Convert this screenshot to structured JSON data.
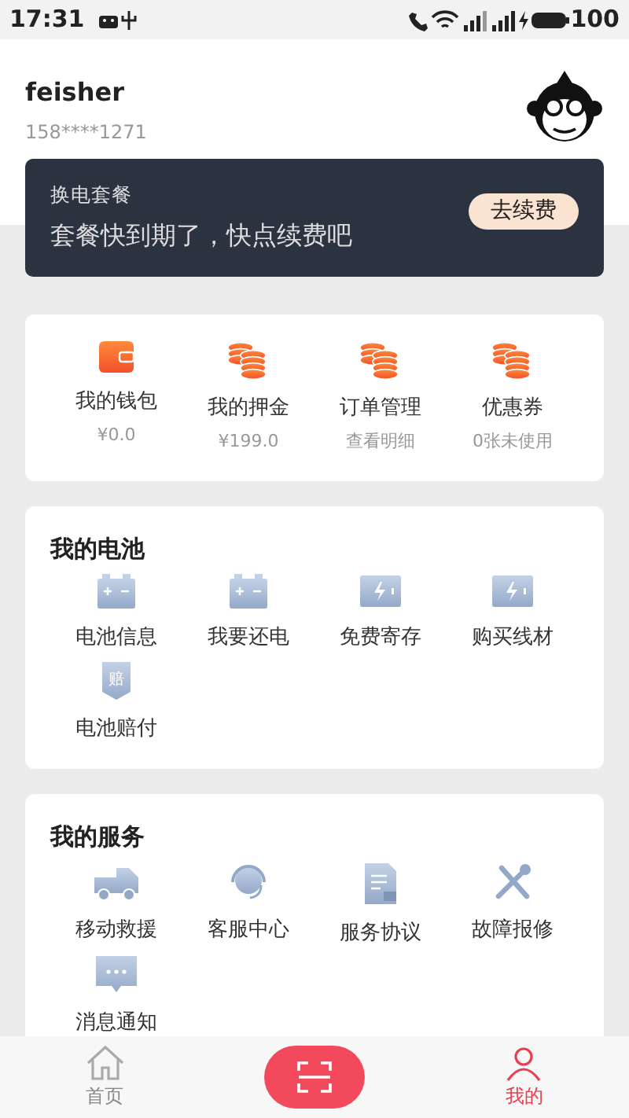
{
  "status_bar": {
    "time": "17:31",
    "battery": "100"
  },
  "profile": {
    "name": "feisher",
    "phone": "158****1271"
  },
  "plan": {
    "title": "换电套餐",
    "message": "套餐快到期了，快点续费吧",
    "button": "去续费"
  },
  "wallet": [
    {
      "kind": "wallet",
      "label": "我的钱包",
      "sub": "¥0.0"
    },
    {
      "kind": "coins",
      "label": "我的押金",
      "sub": "¥199.0"
    },
    {
      "kind": "coins",
      "label": "订单管理",
      "sub": "查看明细"
    },
    {
      "kind": "coins",
      "label": "优惠券",
      "sub": "0张未使用"
    }
  ],
  "battery_section": {
    "title": "我的电池",
    "items": [
      {
        "kind": "battery",
        "label": "电池信息"
      },
      {
        "kind": "battery",
        "label": "我要还电"
      },
      {
        "kind": "charge",
        "label": "免费寄存"
      },
      {
        "kind": "charge",
        "label": "购买线材"
      },
      {
        "kind": "shield",
        "label": "电池赔付",
        "glyph": "赔"
      }
    ]
  },
  "services": {
    "title": "我的服务",
    "items": [
      {
        "kind": "truck",
        "label": "移动救援"
      },
      {
        "kind": "headset",
        "label": "客服中心"
      },
      {
        "kind": "document",
        "label": "服务协议"
      },
      {
        "kind": "tools",
        "label": "故障报修"
      },
      {
        "kind": "chat",
        "label": "消息通知"
      }
    ]
  },
  "tab_bar": [
    {
      "kind": "home",
      "label": "首页",
      "selected": false
    },
    {
      "kind": "scan",
      "selected": false
    },
    {
      "kind": "profile",
      "label": "我的",
      "selected": true
    }
  ]
}
